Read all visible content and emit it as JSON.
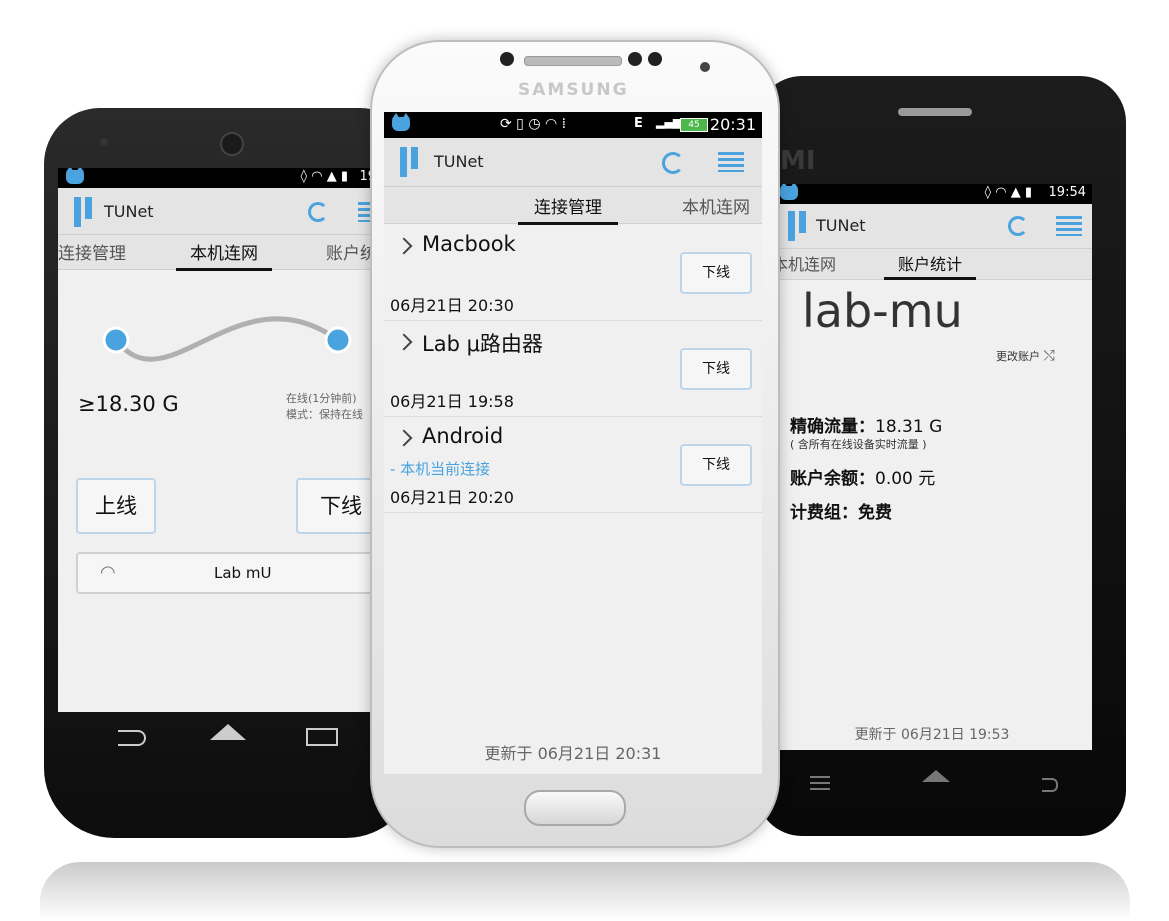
{
  "colors": {
    "accent": "#4aa3df",
    "link": "#4aa3df"
  },
  "app_title": "TUNet",
  "left_phone": {
    "status_time": "19",
    "tabs": [
      "连接管理",
      "本机连网",
      "账户统"
    ],
    "traffic": "≥18.30 G",
    "status_line1": "在线(1分钟前)",
    "status_line2": "模式：保持在线",
    "online_button": "上线",
    "offline_button": "下线",
    "wifi_name": "Lab mU"
  },
  "center_phone": {
    "brand": "SAMSUNG",
    "status_time": "20:31",
    "status_network": "E",
    "battery": "45",
    "tabs": [
      "连接管理",
      "本机连网"
    ],
    "devices": [
      {
        "name": "Macbook",
        "note": "",
        "time": "06月21日 20:30",
        "action": "下线"
      },
      {
        "name": "Lab μ路由器",
        "note": "",
        "time": "06月21日 19:58",
        "action": "下线"
      },
      {
        "name": "Android",
        "note": "- 本机当前连接",
        "time": "06月21日 20:20",
        "action": "下线"
      }
    ],
    "updated": "更新于 06月21日 20:31"
  },
  "right_phone": {
    "brand": "MI",
    "status_time": "19:54",
    "tabs": [
      "本机连网",
      "账户统计"
    ],
    "username": "lab-mu",
    "change_account": "更改账户",
    "precise_traffic_label": "精确流量：",
    "precise_traffic_value": "18.31 G",
    "precise_traffic_note": "( 含所有在线设备实时流量 )",
    "balance_label": "账户余额：",
    "balance_value": "0.00 元",
    "billing_label": "计费组：",
    "billing_value": "免费",
    "updated": "更新于 06月21日 19:53"
  }
}
